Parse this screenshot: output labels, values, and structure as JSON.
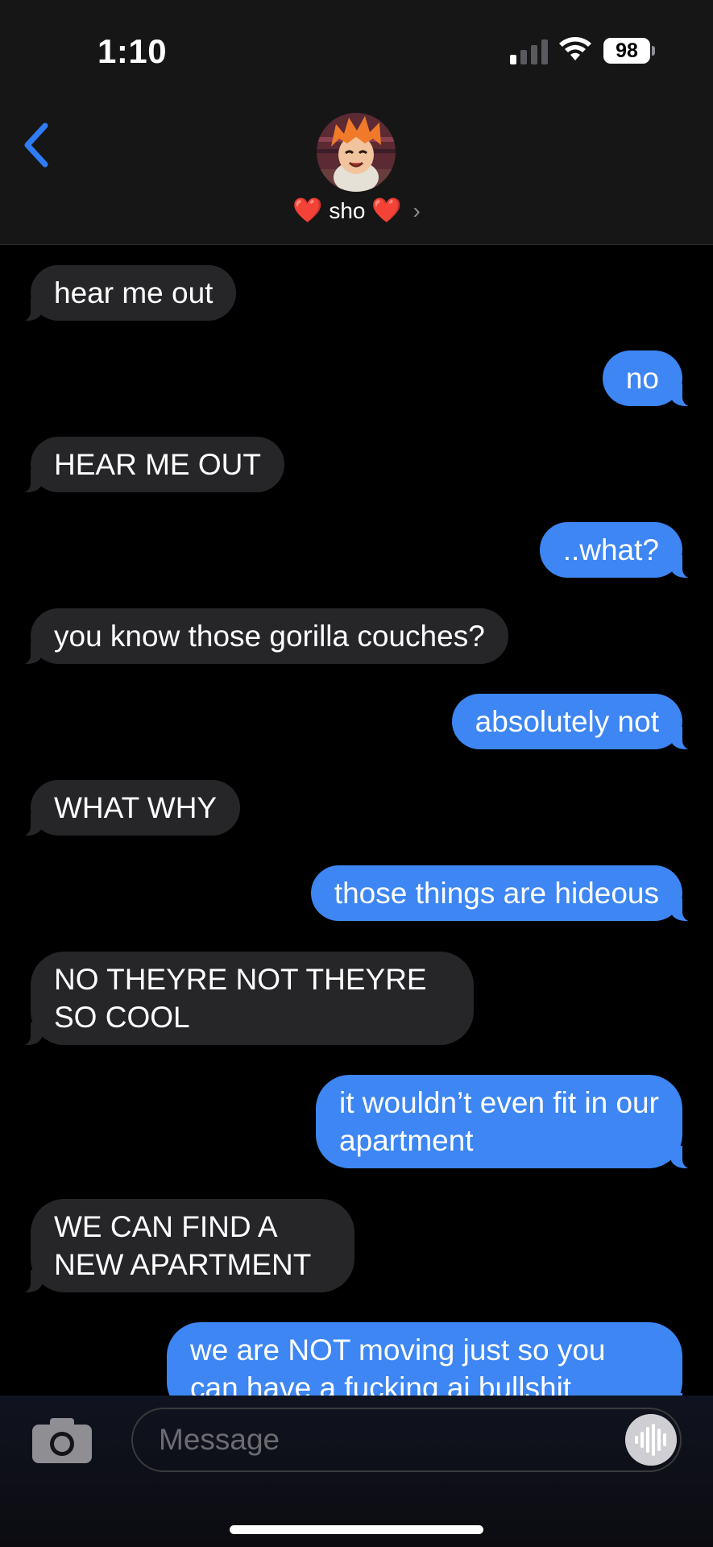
{
  "status_bar": {
    "time": "1:10",
    "battery_level": "98",
    "signal_bars_active": 1,
    "signal_bars_total": 4,
    "icons": [
      "cellular-signal-icon",
      "wifi-icon",
      "battery-icon"
    ]
  },
  "header": {
    "back_icon": "chevron-left-icon",
    "contact_avatar": "anime-character-avatar",
    "contact_name": "sho",
    "name_decoration_left": "❤️",
    "name_decoration_right": "❤️",
    "details_chevron": "›"
  },
  "messages": [
    {
      "direction": "in",
      "text": "hear me out"
    },
    {
      "direction": "out",
      "text": "no"
    },
    {
      "direction": "in",
      "text": "HEAR ME OUT"
    },
    {
      "direction": "out",
      "text": "..what?"
    },
    {
      "direction": "in",
      "text": "you know those gorilla couches?"
    },
    {
      "direction": "out",
      "text": "absolutely not"
    },
    {
      "direction": "in",
      "text": "WHAT WHY"
    },
    {
      "direction": "out",
      "text": "those things are hideous"
    },
    {
      "direction": "in",
      "text": "NO THEYRE NOT THEYRE SO COOL"
    },
    {
      "direction": "out",
      "text": "it wouldn’t even fit in our apartment"
    },
    {
      "direction": "in",
      "text": "WE CAN FIND A NEW APARTMENT"
    },
    {
      "direction": "out",
      "text": "we are NOT moving just so you can have a fucking ai bullshit"
    }
  ],
  "composer": {
    "camera_icon": "camera-icon",
    "placeholder": "Message",
    "voice_icon": "voice-waveform-icon"
  },
  "colors": {
    "header_bg": "#161616",
    "incoming_bubble": "#262629",
    "outgoing_bubble": "#3d86f3",
    "accent_blue": "#2f7cf6",
    "heart_red": "#ff2d3b"
  }
}
